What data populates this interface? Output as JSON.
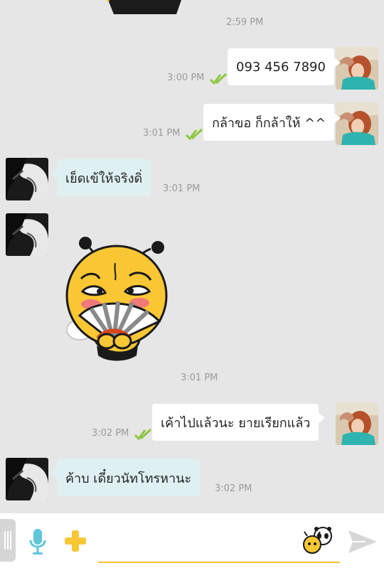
{
  "messages": [
    {
      "id": "m0",
      "time": "2:59 PM"
    },
    {
      "id": "m1",
      "direction": "out",
      "text": "093 456 7890",
      "time": "3:00 PM"
    },
    {
      "id": "m2",
      "direction": "out",
      "text": "กล้าขอ ก็กล้าให้ ^^",
      "time": "3:01 PM"
    },
    {
      "id": "m3",
      "direction": "in",
      "text": "เย็ดเข้ให้จริงดิ่",
      "time": "3:01 PM"
    },
    {
      "id": "m4",
      "direction": "in",
      "sticker": "bee-fan-sticker",
      "time": "3:01 PM"
    },
    {
      "id": "m5",
      "direction": "out",
      "text": "เค้าไปแล้วนะ ยายเรียกแล้ว",
      "time": "3:02 PM"
    },
    {
      "id": "m6",
      "direction": "in",
      "text": "ค้าบ เดี๋ยวนัทโทรหานะ",
      "time": "3:02 PM"
    }
  ],
  "input": {
    "value": "",
    "placeholder": "",
    "icons": [
      "drawer-handle-icon",
      "microphone-icon",
      "plus-icon",
      "sticker-emoji-icon",
      "send-icon"
    ]
  },
  "colors": {
    "background": "#e6e6e6",
    "outgoing_bubble": "#ffffff",
    "incoming_bubble": "#dff0f3",
    "read_ticks": "#8dc63f",
    "accent_yellow": "#f9c734",
    "mic_blue": "#5ec6d8"
  }
}
